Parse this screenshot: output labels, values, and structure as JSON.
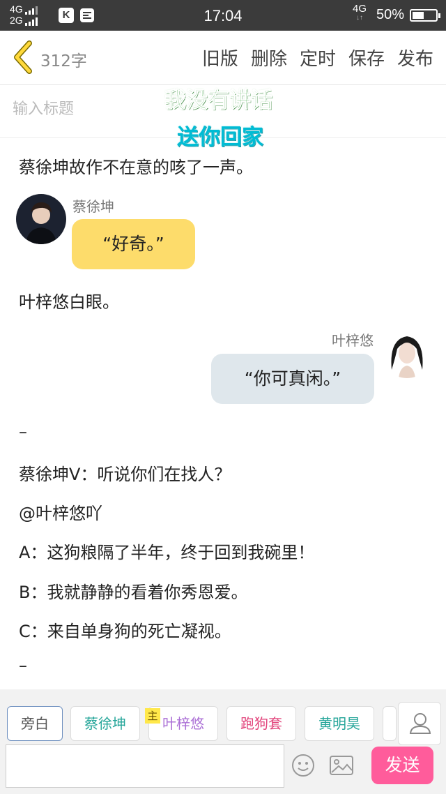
{
  "status_bar": {
    "net_line1": "4G",
    "net_line2": "2G",
    "app_icon_1": "K",
    "time": "17:04",
    "network_right": "4G",
    "battery_text": "50%",
    "battery_level": 0.5
  },
  "header": {
    "back_icon": "chevron-left-icon",
    "word_count": "312字",
    "actions": [
      "旧版",
      "删除",
      "定时",
      "保存",
      "发布"
    ]
  },
  "title_field": {
    "placeholder": "输入标题"
  },
  "watermark": {
    "line1": "我没有讲话",
    "line2": "送你回家"
  },
  "content": {
    "para1": "蔡徐坤故作不在意的咳了一声。",
    "msg1": {
      "speaker": "蔡徐坤",
      "text": "“好奇。”",
      "bubble_color": "#fddc6b"
    },
    "para2": "叶梓悠白眼。",
    "msg2": {
      "speaker": "叶梓悠",
      "text": "“你可真闲。”",
      "bubble_color": "#dfe7ec"
    },
    "dash1": "–",
    "line1": "蔡徐坤V：听说你们在找人？",
    "line2": "@叶梓悠吖",
    "line3": "A：这狗粮隔了半年，终于回到我碗里！",
    "line4": "B：我就静静的看着你秀恩爱。",
    "line5": "C：来自单身狗的死亡凝视。",
    "dash2": "–"
  },
  "roles": {
    "chips": [
      {
        "label": "旁白",
        "color": "#555555"
      },
      {
        "label": "蔡徐坤",
        "color": "#26a69a"
      },
      {
        "label": "叶梓悠",
        "color": "#ab6fd6"
      },
      {
        "label": "跑狗套",
        "color": "#e2457c"
      },
      {
        "label": "黄明昊",
        "color": "#26a69a"
      }
    ],
    "main_tag": "主"
  },
  "composer": {
    "send_label": "发送",
    "send_color": "#ff5c9b"
  }
}
